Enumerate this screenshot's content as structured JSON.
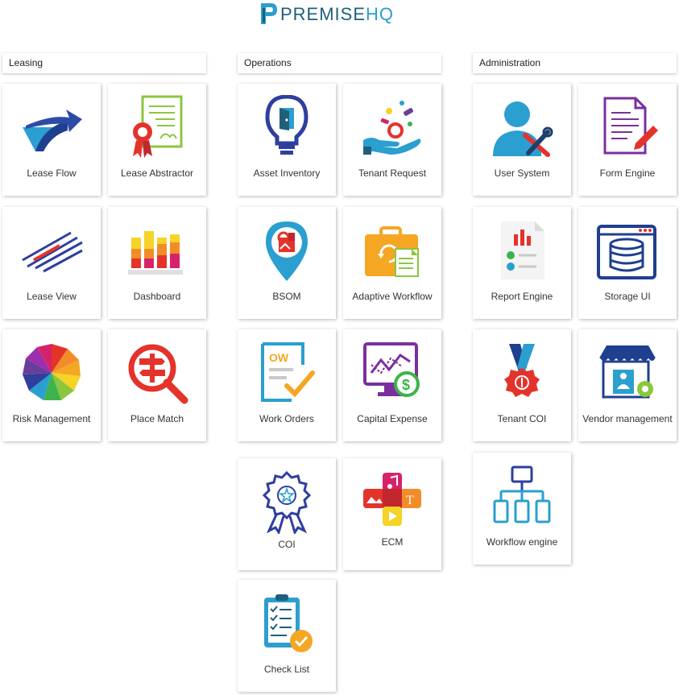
{
  "brand": {
    "name_part1": "PREMISE",
    "name_part2": "HQ",
    "logo_icon": "premisehq-logo-icon"
  },
  "sections": {
    "leasing": "Leasing",
    "operations": "Operations",
    "administration": "Administration"
  },
  "tiles": {
    "lease_flow": "Lease Flow",
    "lease_abstractor": "Lease Abstractor",
    "lease_view": "Lease View",
    "dashboard": "Dashboard",
    "risk_management": "Risk Management",
    "place_match": "Place Match",
    "asset_inventory": "Asset Inventory",
    "tenant_request": "Tenant Request",
    "bsom": "BSOM",
    "adaptive_workflow": "Adaptive Workflow",
    "work_orders": "Work Orders",
    "capital_expense": "Capital Expense",
    "coi": "COI",
    "ecm": "ECM",
    "check_list": "Check List",
    "user_system": "User System",
    "form_engine": "Form Engine",
    "report_engine": "Report Engine",
    "storage_ui": "Storage UI",
    "tenant_coi": "Tenant COI",
    "vendor_management": "Vendor management",
    "workflow_engine": "Workflow engine"
  },
  "icons": {
    "work_orders_text": "OW",
    "ecm_text": "T"
  },
  "colors": {
    "brand_dark": "#1f5f7a",
    "brand_light": "#2a9fd0",
    "tile_bg": "#ffffff"
  }
}
